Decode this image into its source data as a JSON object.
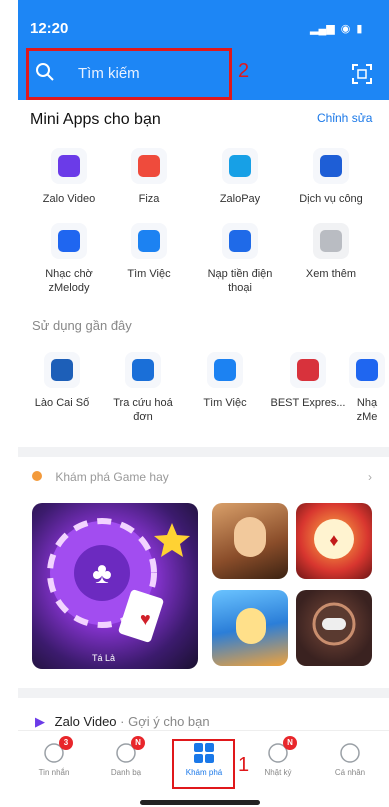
{
  "status_bar": {
    "time": "12:20"
  },
  "search": {
    "placeholder": "Tìm kiếm"
  },
  "annotations": {
    "search_label": "2",
    "nav_label": "1"
  },
  "mini_apps": {
    "title": "Mini Apps cho bạn",
    "edit_label": "Chỉnh sửa",
    "items": [
      {
        "label": "Zalo Video",
        "icon": "play-icon",
        "color": "#6b3be8"
      },
      {
        "label": "Fiza",
        "icon": "grid-icon",
        "color": "#ef4b3c"
      },
      {
        "label": "ZaloPay",
        "icon": "wallet-icon",
        "color": "#17a0e6"
      },
      {
        "label": "Dịch vụ công",
        "icon": "building-icon",
        "color": "#1e5ed6"
      },
      {
        "label": "Nhạc chờ zMelody",
        "icon": "music-icon",
        "color": "#1f66f0"
      },
      {
        "label": "Tìm Việc",
        "icon": "briefcase-icon",
        "color": "#1c82f2"
      },
      {
        "label": "Nạp tiền điện thoại",
        "icon": "phone-icon",
        "color": "#1f6ae8"
      },
      {
        "label": "Xem thêm",
        "icon": "more-grid-icon",
        "color": "#b9bcc2"
      }
    ]
  },
  "recent": {
    "title": "Sử dụng gần đây",
    "items": [
      {
        "label": "Lào Cai Số",
        "icon": "lao-cai-icon",
        "color": "#1d5fb8"
      },
      {
        "label": "Tra cứu hoá đơn",
        "icon": "vnpt-icon",
        "color": "#1a6fd8"
      },
      {
        "label": "Tìm Việc",
        "icon": "briefcase-icon",
        "color": "#1c82f2"
      },
      {
        "label": "BEST Expres...",
        "icon": "best-express-icon",
        "color": "#d8323c"
      },
      {
        "label": "Nhạ zMe",
        "icon": "music-icon",
        "color": "#1f66f0"
      }
    ]
  },
  "games": {
    "header_label": "Khám phá Game hay",
    "items": [
      {
        "label": "Tá Lả"
      },
      {
        "label": ""
      },
      {
        "label": ""
      },
      {
        "label": ""
      },
      {
        "label": ""
      }
    ]
  },
  "video_section": {
    "title": "Zalo Video",
    "subtitle": "· Gợi ý cho bạn"
  },
  "bottom_nav": [
    {
      "label": "Tin nhắn",
      "icon": "chat-icon",
      "badge": "3"
    },
    {
      "label": "Danh bạ",
      "icon": "contacts-icon",
      "badge": "N"
    },
    {
      "label": "Khám phá",
      "icon": "explore-grid-icon",
      "badge": ""
    },
    {
      "label": "Nhật ký",
      "icon": "clock-icon",
      "badge": "N"
    },
    {
      "label": "Cá nhân",
      "icon": "user-icon",
      "badge": ""
    }
  ],
  "colors": {
    "header": "#1d86f5",
    "accent": "#1a78e8",
    "annotation": "#e0181b"
  }
}
